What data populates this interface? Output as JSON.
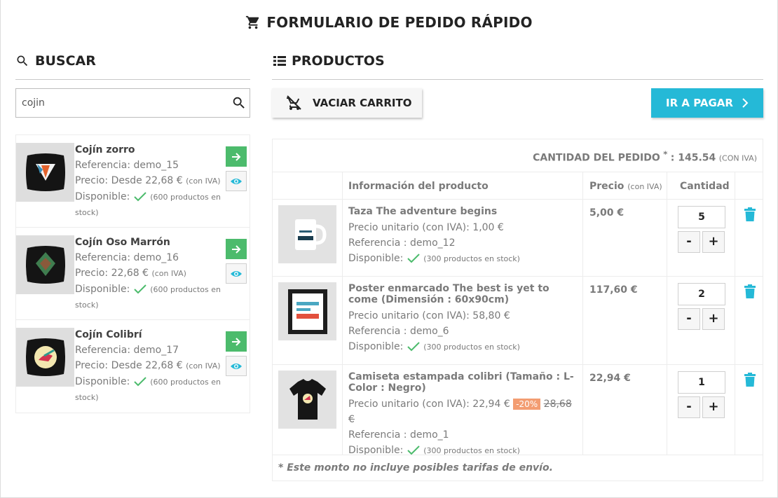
{
  "title": "FORMULARIO DE PEDIDO RÁPIDO",
  "search": {
    "heading": "BUSCAR",
    "value": "cojin",
    "results": [
      {
        "name": "Cojín zorro",
        "reference": "Referencia: demo_15",
        "price": "Precio: Desde 22,68 €",
        "tax": "(con IVA)",
        "available": "Disponible:",
        "stock": "(600 productos en",
        "stock2": "stock)"
      },
      {
        "name": "Cojín Oso Marrón",
        "reference": "Referencia: demo_16",
        "price": "Precio: 22,68 €",
        "tax": "(con IVA)",
        "available": "Disponible:",
        "stock": "(600 productos en",
        "stock2": "stock)"
      },
      {
        "name": "Cojín Colibrí",
        "reference": "Referencia: demo_17",
        "price": "Precio: Desde 22,68 €",
        "tax": "(con IVA)",
        "available": "Disponible:",
        "stock": "(600 productos en",
        "stock2": "stock)"
      }
    ]
  },
  "products": {
    "heading": "PRODUCTOS",
    "empty_cart": "VACIAR CARRITO",
    "checkout": "IR A PAGAR",
    "total_label": "CANTIDAD DEL PEDIDO",
    "total_star": "*",
    "total_value": ": 145.54",
    "total_tax": "(CON IVA)",
    "col_info": "Información del producto",
    "col_price": "Precio",
    "col_price_tax": "(con IVA)",
    "col_qty": "Cantidad",
    "rows": [
      {
        "name": "Taza The adventure begins",
        "unit": "Precio unitario (con IVA): 1,00 €",
        "reference": "Referencia : demo_12",
        "available": "Disponible:",
        "stock": "(300 productos en stock)",
        "price": "5,00 €",
        "qty": "5"
      },
      {
        "name": "Poster enmarcado The best is yet to come (Dimensión : 60x90cm)",
        "unit": "Precio unitario (con IVA): 58,80 €",
        "reference": "Referencia : demo_6",
        "available": "Disponible:",
        "stock": "(300 productos en stock)",
        "price": "117,60 €",
        "qty": "2"
      },
      {
        "name": "Camiseta estampada colibri (Tamaño : L- Color : Negro)",
        "unit": "Precio unitario (con IVA): 22,94 €",
        "discount": "-20%",
        "old_price": "28,68 €",
        "reference": "Referencia : demo_1",
        "available": "Disponible:",
        "stock": "(300 productos en stock)",
        "price": "22,94 €",
        "qty": "1"
      }
    ],
    "minus": "-",
    "plus": "+",
    "footnote": "* Este monto no incluye posibles tarifas de envío."
  },
  "colors": {
    "accent": "#25b9d7",
    "add_green": "#4cbb6c",
    "discount": "#f39d72"
  }
}
